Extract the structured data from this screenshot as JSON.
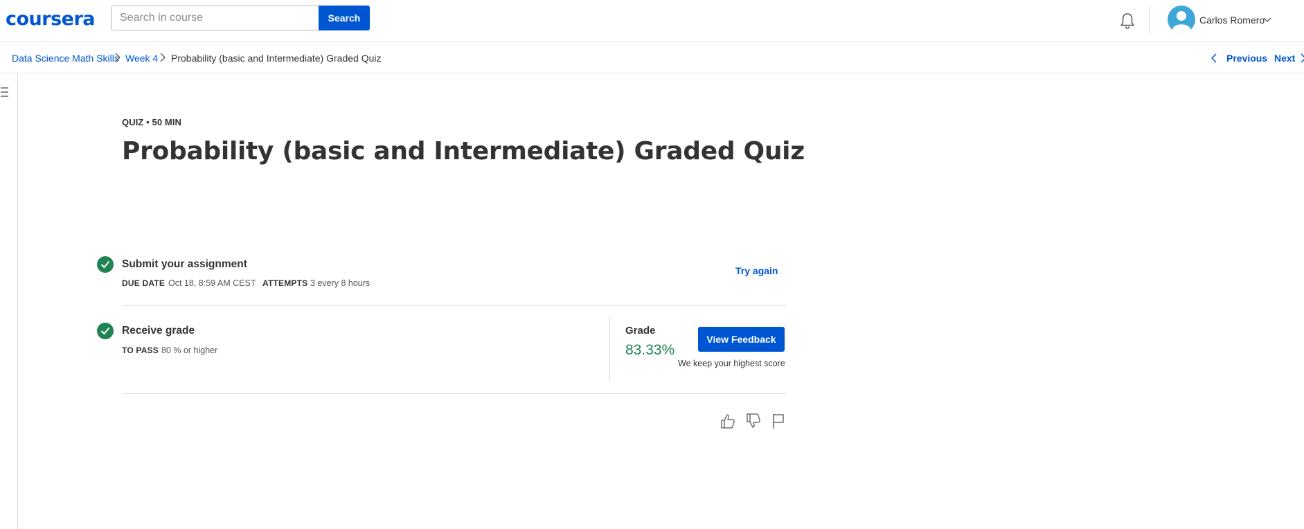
{
  "header": {
    "logo": "coursera",
    "search": {
      "placeholder": "Search in course",
      "value": "",
      "button_label": "Search"
    },
    "user_name": "Carlos Romero"
  },
  "breadcrumb": {
    "items": [
      "Data Science Math Skills",
      "Week 4",
      "Probability (basic and Intermediate) Graded Quiz"
    ],
    "previous_label": "Previous",
    "next_label": "Next"
  },
  "quiz": {
    "meta": "QUIZ • 50 MIN",
    "title": "Probability (basic and Intermediate) Graded Quiz"
  },
  "submit": {
    "title": "Submit your assignment",
    "due_label": "DUE DATE",
    "due_value": "Oct 18, 8:59 AM CEST",
    "attempts_label": "ATTEMPTS",
    "attempts_value": "3 every 8 hours",
    "try_again_label": "Try again"
  },
  "receive": {
    "title": "Receive grade",
    "pass_label": "TO PASS",
    "pass_value": "80 % or higher",
    "grade_label": "Grade",
    "grade_value": "83.33%",
    "view_feedback_label": "View Feedback",
    "keep_note": "We keep your highest score"
  },
  "colors": {
    "brand": "#0056d2",
    "success": "#1f8354",
    "text": "#333333",
    "avatar": "#3ea7d8"
  },
  "icons": [
    "bell-icon",
    "avatar-icon",
    "chevron-down-icon",
    "chevron-right-icon",
    "chevron-left-icon",
    "menu-icon",
    "check-icon",
    "thumbs-up-icon",
    "thumbs-down-icon",
    "flag-icon"
  ]
}
